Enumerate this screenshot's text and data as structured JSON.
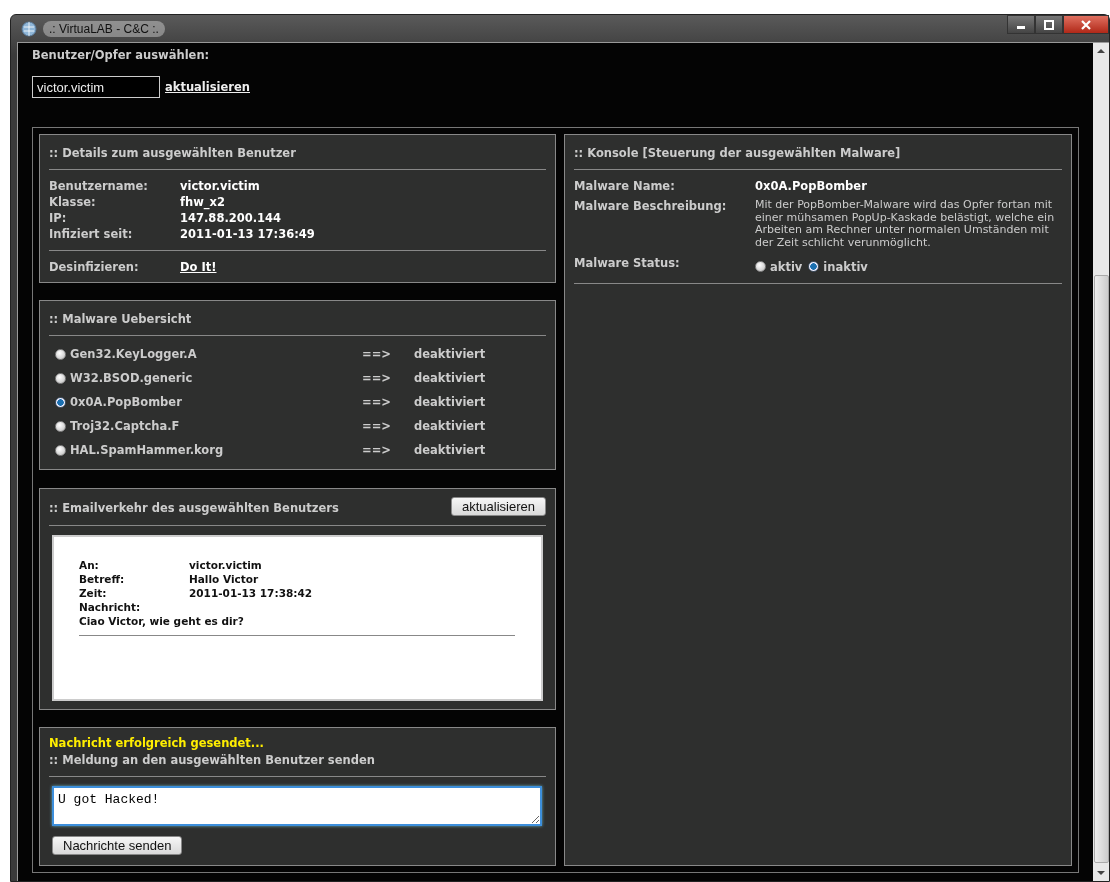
{
  "window": {
    "title": ".: VirtuaLAB - C&C :."
  },
  "user_select": {
    "label": "Benutzer/Opfer auswählen:",
    "value": "victor.victim",
    "link": "aktualisieren"
  },
  "details": {
    "title": ":: Details zum ausgewählten Benutzer",
    "fields": [
      {
        "label": "Benutzername:",
        "value": "victor.victim"
      },
      {
        "label": "Klasse:",
        "value": "fhw_x2"
      },
      {
        "label": "IP:",
        "value": "147.88.200.144"
      },
      {
        "label": "Infiziert seit:",
        "value": "2011-01-13 17:36:49"
      }
    ],
    "disinfect_label": "Desinfizieren:",
    "disinfect_link": "Do It!"
  },
  "malware": {
    "title": ":: Malware Uebersicht",
    "items": [
      {
        "name": "Gen32.KeyLogger.A",
        "arrow": "==>",
        "status": "deaktiviert",
        "selected": false
      },
      {
        "name": "W32.BSOD.generic",
        "arrow": "==>",
        "status": "deaktiviert",
        "selected": false
      },
      {
        "name": "0x0A.PopBomber",
        "arrow": "==>",
        "status": "deaktiviert",
        "selected": true
      },
      {
        "name": "Troj32.Captcha.F",
        "arrow": "==>",
        "status": "deaktiviert",
        "selected": false
      },
      {
        "name": "HAL.SpamHammer.korg",
        "arrow": "==>",
        "status": "deaktiviert",
        "selected": false
      }
    ]
  },
  "email": {
    "title": ":: Emailverkehr des ausgewählten Benutzers",
    "button": "aktualisieren",
    "fields": [
      {
        "label": "An:",
        "value": "victor.victim"
      },
      {
        "label": "Betreff:",
        "value": "Hallo Victor"
      },
      {
        "label": "Zeit:",
        "value": "2011-01-13 17:38:42"
      },
      {
        "label": "Nachricht:"
      }
    ],
    "message": "Ciao Victor, wie geht es dir?"
  },
  "send": {
    "notice": "Nachricht erfolgreich gesendet...",
    "title": ":: Meldung an den ausgewählten Benutzer senden",
    "value": "U got Hacked!",
    "button": "Nachrichte senden"
  },
  "console": {
    "title": ":: Konsole [Steuerung der ausgewählten Malware]",
    "name_label": "Malware Name:",
    "name": "0x0A.PopBomber",
    "desc_label": "Malware Beschreibung:",
    "description": "Mit der PopBomber-Malware wird das Opfer fortan mit einer mühsamen PopUp-Kaskade belästigt, welche ein Arbeiten am Rechner unter normalen Umständen mit der Zeit schlicht verunmöglicht.",
    "status_label": "Malware Status:",
    "options": [
      {
        "label": "aktiv",
        "selected": false
      },
      {
        "label": "inaktiv",
        "selected": true
      }
    ]
  }
}
